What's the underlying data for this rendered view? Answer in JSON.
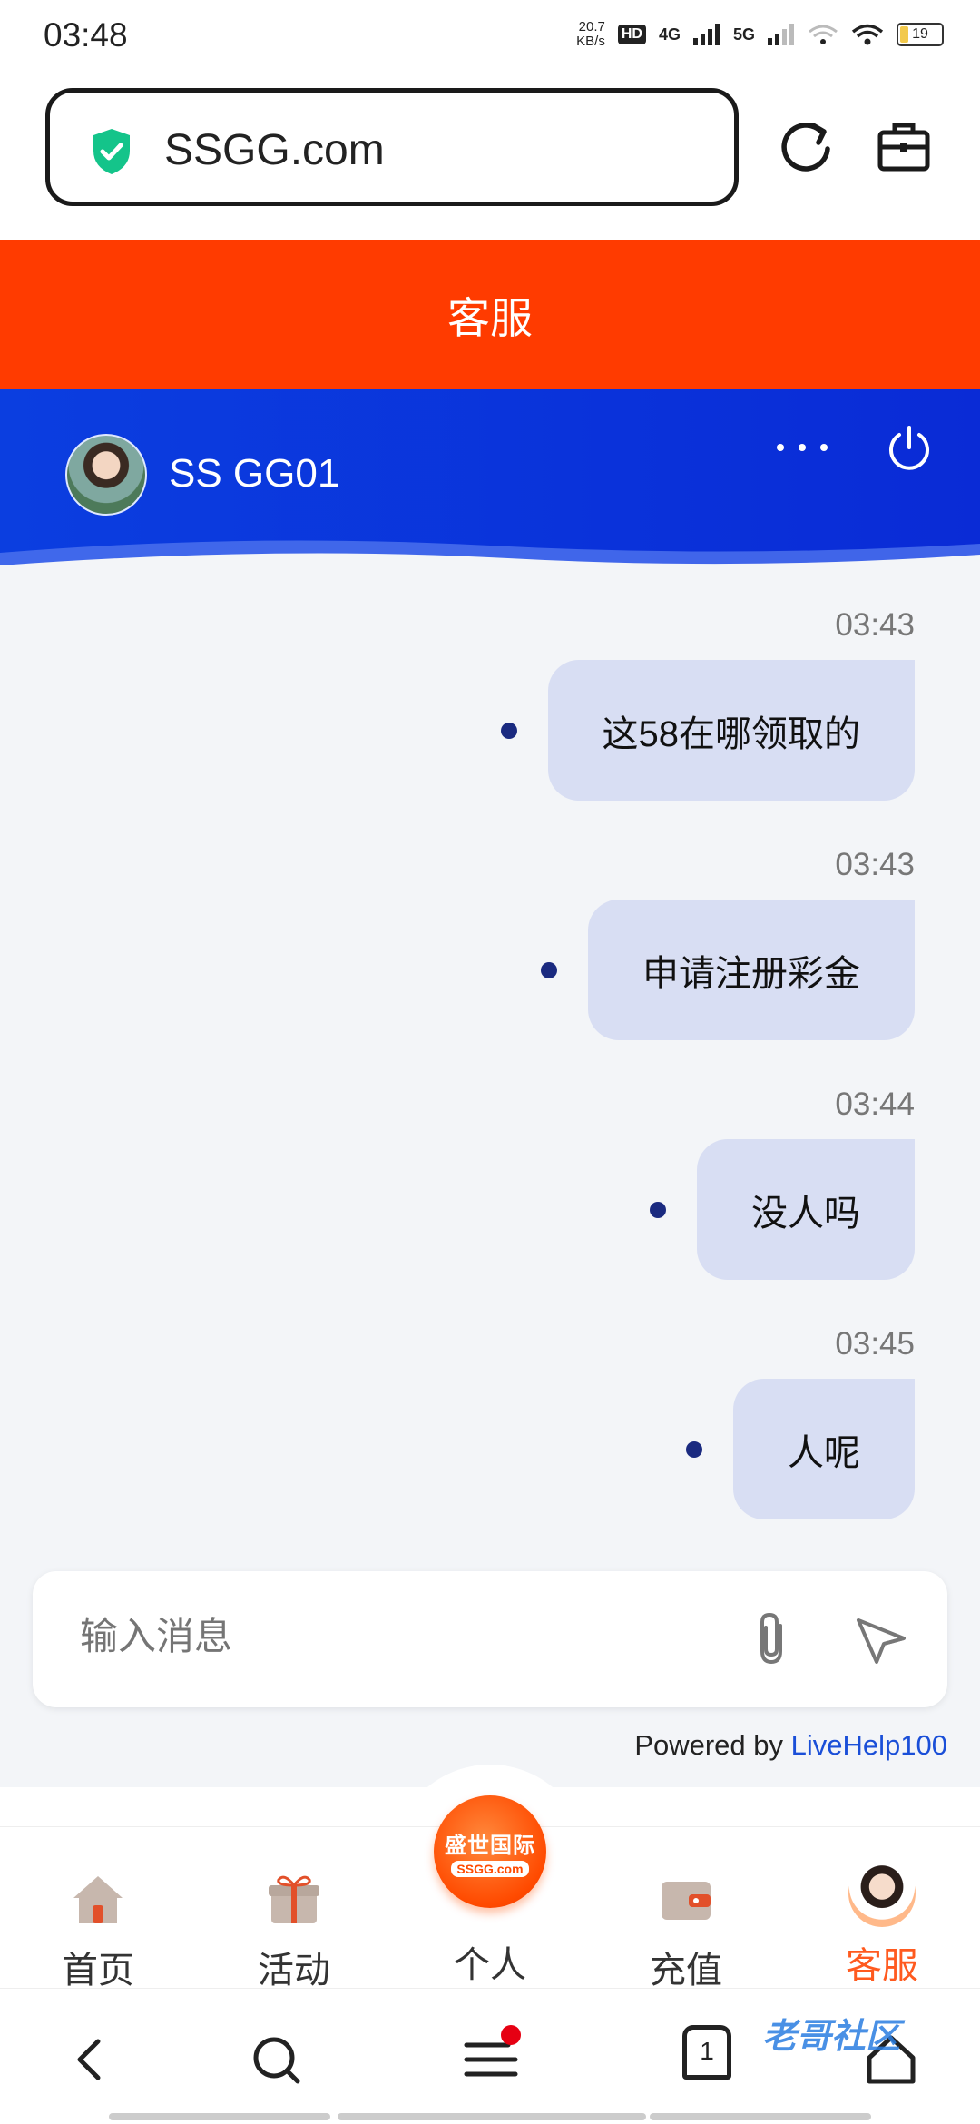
{
  "status_bar": {
    "time": "03:48",
    "net_speed": "20.7",
    "net_unit": "KB/s",
    "hd": "HD",
    "sig1": "4G",
    "sig2": "5G",
    "battery": "19"
  },
  "browser": {
    "url": "SSGG.com"
  },
  "page_title": "客服",
  "chat_header": {
    "agent_name": "SS GG01"
  },
  "messages": [
    {
      "time": "03:43",
      "text": "这58在哪领取的"
    },
    {
      "time": "03:43",
      "text": "申请注册彩金"
    },
    {
      "time": "03:44",
      "text": "没人吗"
    },
    {
      "time": "03:45",
      "text": "人呢"
    }
  ],
  "composer": {
    "placeholder": "输入消息"
  },
  "powered": {
    "prefix": "Powered by ",
    "link": "LiveHelp100"
  },
  "tabbar": {
    "home": "首页",
    "activity": "活动",
    "personal": "个人",
    "recharge": "充值",
    "service": "客服",
    "logo_cn": "盛世国际",
    "logo_en": "SSGG.com"
  },
  "navbar": {
    "tab_count": "1"
  },
  "watermark": "老哥社区",
  "colors": {
    "brand_orange": "#ff3b00",
    "chat_blue": "#0b3ee0",
    "bubble": "#d8def3",
    "active_tab": "#ff5a1f"
  }
}
